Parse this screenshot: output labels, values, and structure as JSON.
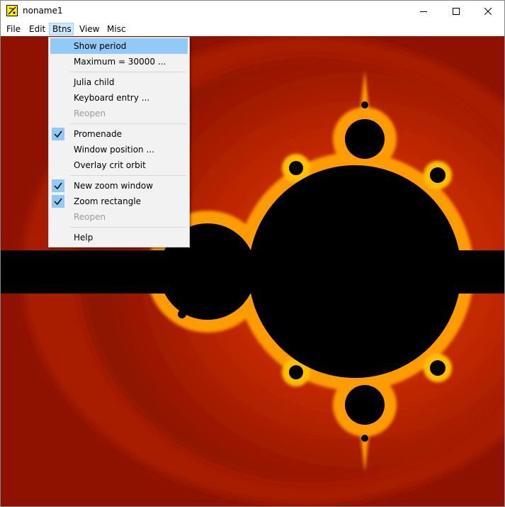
{
  "window": {
    "title": "noname1"
  },
  "menubar": {
    "items": [
      "File",
      "Edit",
      "Btns",
      "View",
      "Misc"
    ],
    "active": "Btns"
  },
  "dropdown": {
    "items": [
      {
        "label": "Show period",
        "highlighted": true
      },
      {
        "label": "Maximum = 30000 ..."
      },
      {
        "label": "Julia child"
      },
      {
        "label": "Keyboard entry ..."
      },
      {
        "label": "Reopen",
        "disabled": true
      },
      {
        "label": "Promenade",
        "checked": true
      },
      {
        "label": "Window position ..."
      },
      {
        "label": "Overlay crit orbit"
      },
      {
        "label": "New zoom window",
        "checked": true
      },
      {
        "label": "Zoom rectangle",
        "checked": true
      },
      {
        "label": "Reopen",
        "disabled": true
      },
      {
        "label": "Help"
      }
    ]
  },
  "colors": {
    "background_outer": "#8f1200",
    "background_band": "#c02800",
    "fractal_edge": "#ff9c00",
    "fractal_glow": "#ffe030",
    "set_interior": "#000000",
    "menu_highlight": "#91c9f7"
  }
}
